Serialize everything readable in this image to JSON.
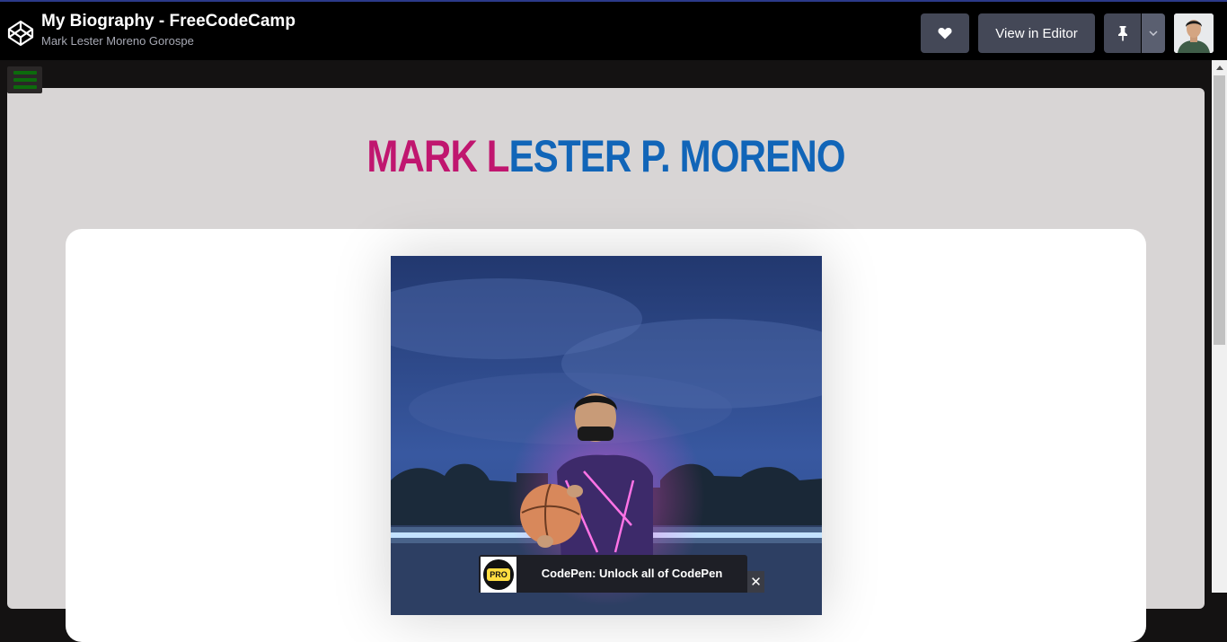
{
  "header": {
    "pen_title": "My Biography - FreeCodeCamp",
    "author": "Mark Lester Moreno Gorospe",
    "view_in_editor_label": "View in Editor",
    "icons": [
      "codepen-logo-icon",
      "heart-icon",
      "pin-icon",
      "chevron-down-icon",
      "user-avatar"
    ]
  },
  "page": {
    "heading_part1": "MARK L",
    "heading_part2": "ESTER P. MORENO",
    "colors": {
      "heading_accent": "#c0166f",
      "heading_main": "#1165b8",
      "background": "#d8d5d5"
    }
  },
  "promo": {
    "badge": "PRO",
    "text": "CodePen: Unlock all of CodePen",
    "close": "✕"
  }
}
